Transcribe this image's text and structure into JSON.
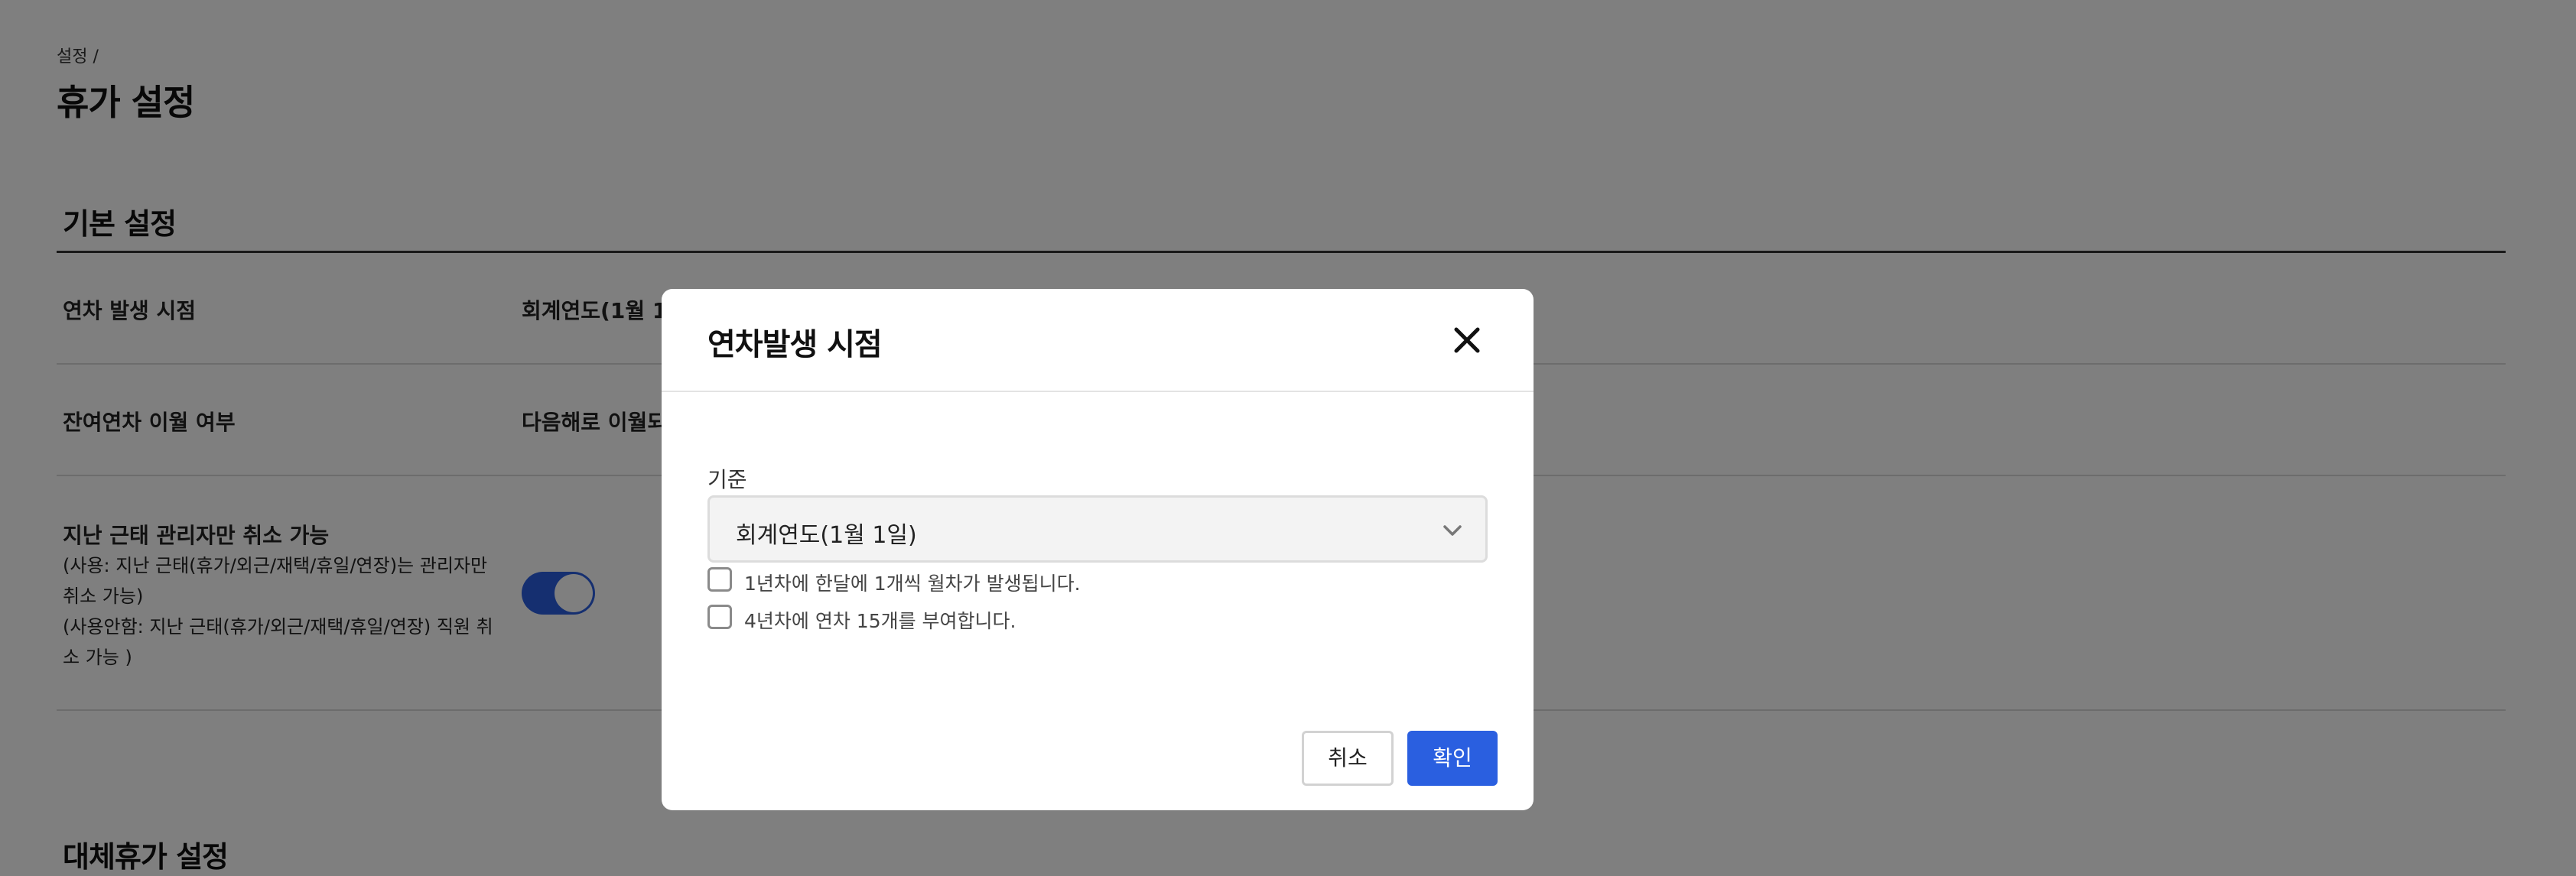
{
  "page": {
    "breadcrumb": "설정 /",
    "title": "휴가 설정"
  },
  "basic_settings": {
    "section_title": "기본 설정",
    "rows": [
      {
        "label": "연차 발생 시점",
        "value": "회계연도(1월 1"
      },
      {
        "label": "잔여연차 이월 여부",
        "value": "다음해로 이월되"
      },
      {
        "label": "지난 근태 관리자만 취소 가능",
        "sub_lines": [
          "(사용: 지난 근태(휴가/외근/재택/휴일/연장)는 관리자만 취소 가능)",
          "(사용안함: 지난 근태(휴가/외근/재택/휴일/연장) 직원 취소 가능 )"
        ],
        "toggle_on": true
      }
    ]
  },
  "alt_leave_settings": {
    "section_title": "대체휴가 설정"
  },
  "modal": {
    "title": "연차발생 시점",
    "field_label": "기준",
    "select_value": "회계연도(1월 1일)",
    "checkboxes": [
      {
        "label": "1년차에 한달에 1개씩 월차가 발생됩니다.",
        "checked": false
      },
      {
        "label": "4년차에 연차 15개를 부여합니다.",
        "checked": false
      }
    ],
    "cancel_label": "취소",
    "confirm_label": "확인"
  },
  "colors": {
    "primary": "#2a5fe0",
    "overlay": "rgba(0,0,0,0.5)"
  },
  "icons": [
    "close-icon",
    "chevron-down-icon",
    "checkbox-icon"
  ]
}
